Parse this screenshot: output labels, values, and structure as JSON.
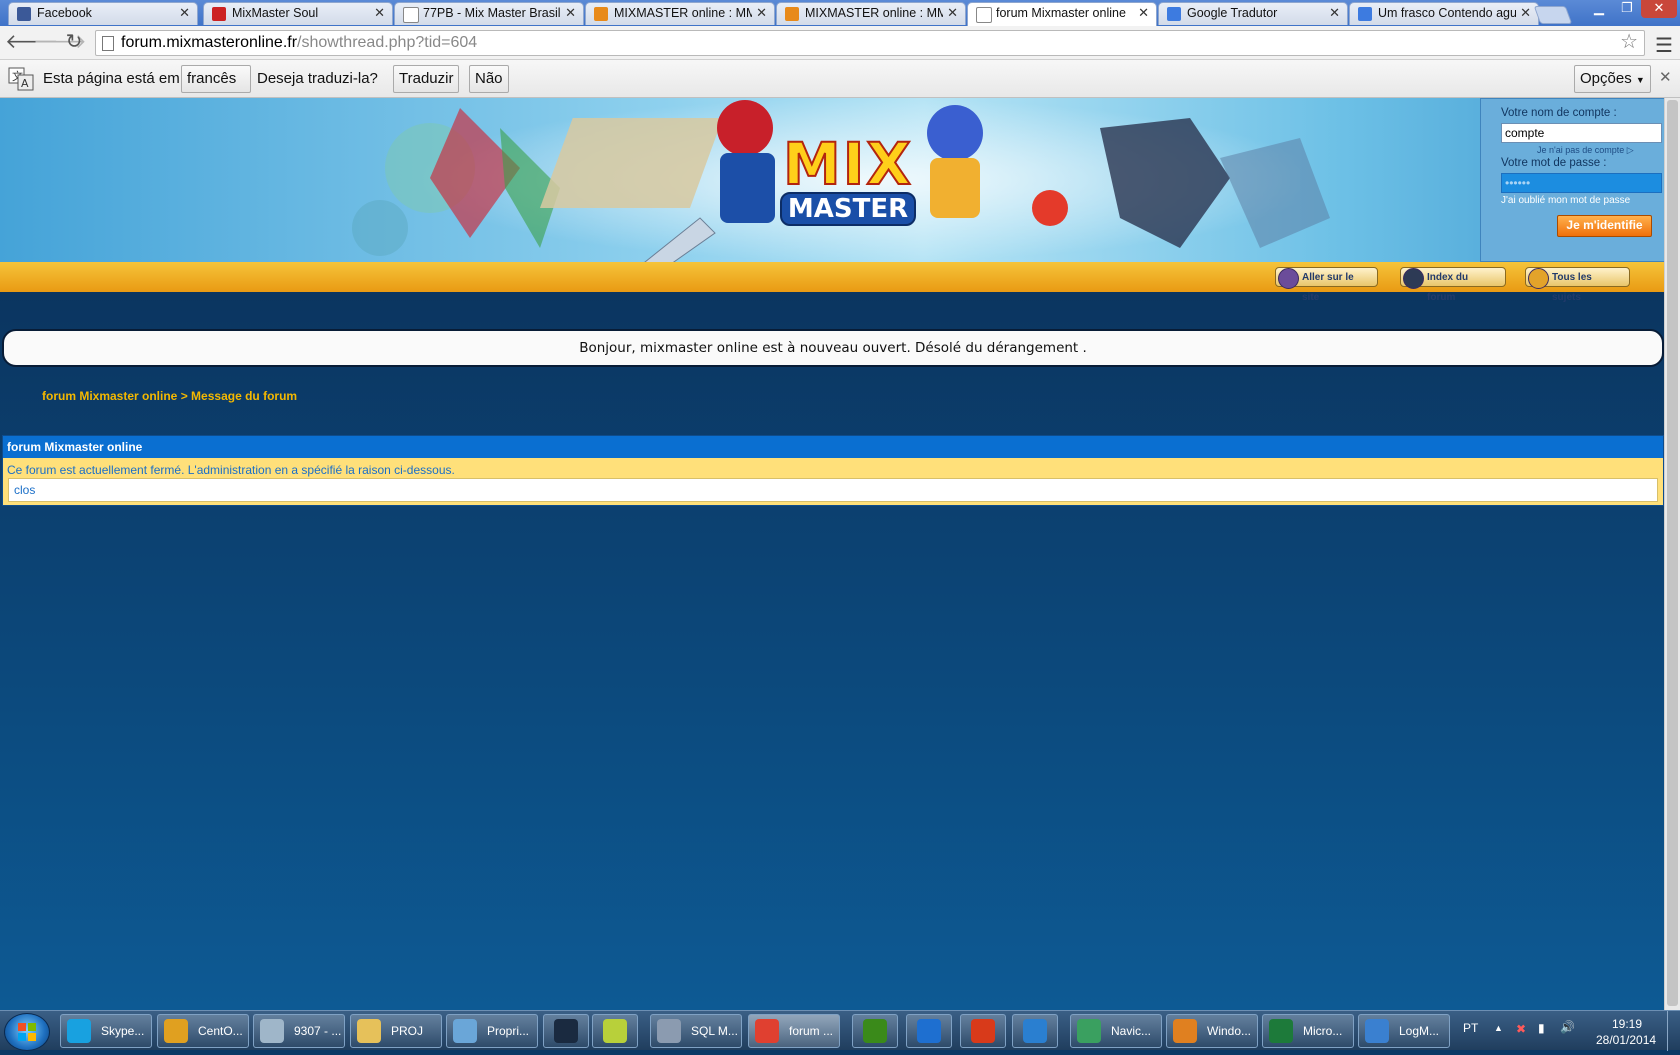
{
  "browser": {
    "tabs": [
      {
        "title": "Facebook",
        "favicon": "facebook-icon",
        "color": "#3b5998",
        "active": false
      },
      {
        "title": "MixMaster Soul",
        "favicon": "bird-icon",
        "color": "#cc2222",
        "active": false
      },
      {
        "title": "77PB - Mix Master Brasil -",
        "favicon": "page-icon",
        "color": "#ffffff",
        "active": false
      },
      {
        "title": "MIXMASTER online : MM",
        "favicon": "mixmaster-icon",
        "color": "#e88a1a",
        "active": false
      },
      {
        "title": "MIXMASTER online : MM",
        "favicon": "mixmaster-icon",
        "color": "#e88a1a",
        "active": false
      },
      {
        "title": "forum Mixmaster online",
        "favicon": "page-icon",
        "color": "#ffffff",
        "active": true
      },
      {
        "title": "Google Tradutor",
        "favicon": "translate-icon",
        "color": "#3d7be0",
        "active": false
      },
      {
        "title": "Um frasco Contendo agu",
        "favicon": "google-icon",
        "color": "#3d7be0",
        "active": false
      }
    ],
    "url_host": "forum.mixmasteronline.fr",
    "url_path": "/showthread.php?tid=604"
  },
  "translate_bar": {
    "prefix": "Esta página está em",
    "language": "francês",
    "question": "Deseja traduzi-la?",
    "translate_button": "Traduzir",
    "no_button": "Não",
    "options_button": "Opções"
  },
  "login": {
    "account_label": "Votre nom de compte :",
    "account_value": "compte",
    "no_account": "Je n'ai pas de compte",
    "password_label": "Votre mot de passe :",
    "password_value": "••••••",
    "forgot": "J'ai oublié mon mot de passe",
    "submit": "Je m'identifie"
  },
  "nav": {
    "site": "Aller sur le site",
    "forum_index": "Index du forum",
    "all_topics": "Tous les sujets"
  },
  "notice": "Bonjour, mixmaster online est à nouveau ouvert. Désolé du dérangement .",
  "breadcrumb": {
    "home": "forum Mixmaster online",
    "separator": " > ",
    "current": "Message du forum"
  },
  "board": {
    "title": "forum Mixmaster online",
    "closed_message": "Ce forum est actuellement fermé. L'administration en a spécifié la raison ci-dessous.",
    "reason": "clos"
  },
  "logo": {
    "line1": "MIX",
    "line2": "MASTER"
  },
  "taskbar": {
    "items": [
      {
        "label": "Skype...",
        "icon": "skype-icon",
        "color": "#18a1e0"
      },
      {
        "label": "CentO...",
        "icon": "vm-icon",
        "color": "#e0a020"
      },
      {
        "label": "9307 - ...",
        "icon": "search-icon",
        "color": "#9fb6c9"
      },
      {
        "label": "PROJ",
        "icon": "folder-icon",
        "color": "#e6c15a"
      },
      {
        "label": "Propri...",
        "icon": "image-icon",
        "color": "#6aa6d8"
      },
      {
        "label": "",
        "icon": "league-icon",
        "color": "#1a2a40"
      },
      {
        "label": "",
        "icon": "winrar-icon",
        "color": "#b8d03a"
      },
      {
        "label": "SQL M...",
        "icon": "sql-icon",
        "color": "#8b9bb0"
      },
      {
        "label": "forum ...",
        "icon": "chrome-icon",
        "color": "#e04030"
      },
      {
        "label": "",
        "icon": "dreamweaver-icon",
        "color": "#3a8a1a"
      },
      {
        "label": "",
        "icon": "teamviewer-icon",
        "color": "#1e6fd0"
      },
      {
        "label": "",
        "icon": "mixmaster-icon",
        "color": "#d83a1a"
      },
      {
        "label": "",
        "icon": "magnifier-icon",
        "color": "#2a7fd0"
      },
      {
        "label": "Navic...",
        "icon": "navicat-icon",
        "color": "#3aa060"
      },
      {
        "label": "Windo...",
        "icon": "media-player-icon",
        "color": "#e08020"
      },
      {
        "label": "Micro...",
        "icon": "excel-icon",
        "color": "#1d7a3a"
      },
      {
        "label": "LogM...",
        "icon": "logmein-icon",
        "color": "#3a80d0"
      }
    ],
    "lang": "PT",
    "time": "19:19",
    "date": "28/01/2014"
  }
}
